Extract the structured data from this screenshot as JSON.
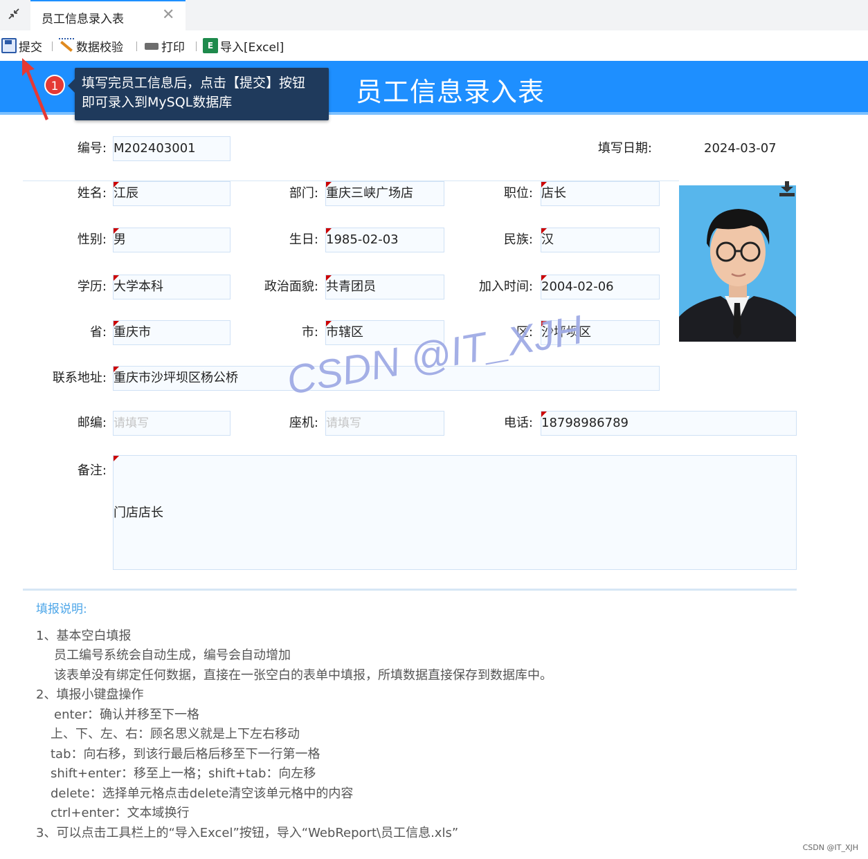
{
  "tab": {
    "title": "员工信息录入表",
    "close": "✕"
  },
  "toolbar": {
    "submit": "提交",
    "validate": "数据校验",
    "print": "打印",
    "import": "导入[Excel]",
    "excel_glyph": "E"
  },
  "banner": {
    "title": "员工信息录入表"
  },
  "annotation": {
    "badge": "1",
    "line1": "填写完员工信息后，点击【提交】按钮",
    "line2": "即可录入到MySQL数据库"
  },
  "form": {
    "id_label": "编号:",
    "id_value": "M202403001",
    "date_label": "填写日期:",
    "date_value": "2024-03-07",
    "name_label": "姓名:",
    "name_value": "江辰",
    "dept_label": "部门:",
    "dept_value": "重庆三峡广场店",
    "position_label": "职位:",
    "position_value": "店长",
    "gender_label": "性别:",
    "gender_value": "男",
    "birth_label": "生日:",
    "birth_value": "1985-02-03",
    "ethnic_label": "民族:",
    "ethnic_value": "汉",
    "edu_label": "学历:",
    "edu_value": "大学本科",
    "politics_label": "政治面貌:",
    "politics_value": "共青团员",
    "join_label": "加入时间:",
    "join_value": "2004-02-06",
    "province_label": "省:",
    "province_value": "重庆市",
    "city_label": "市:",
    "city_value": "市辖区",
    "district_label": "区:",
    "district_value": "沙坪坝区",
    "address_label": "联系地址:",
    "address_value": "重庆市沙坪坝区杨公桥",
    "zip_label": "邮编:",
    "zip_placeholder": "请填写",
    "landline_label": "座机:",
    "landline_placeholder": "请填写",
    "phone_label": "电话:",
    "phone_value": "18798986789",
    "remark_label": "备注:",
    "remark_value": "门店店长"
  },
  "watermark": "CSDN @IT_XJH",
  "notes": {
    "title": "填报说明:",
    "lines": [
      "1、基本空白填报",
      "员工编号系统会自动生成，编号会自动增加",
      "该表单没有绑定任何数据，直接在一张空白的表单中填报，所填数据直接保存到数据库中。",
      "2、填报小键盘操作",
      "enter：确认并移至下一格",
      "上、下、左、右：顾名思义就是上下左右移动",
      "tab：向右移，到该行最后格后移至下一行第一格",
      "shift+enter：移至上一格；shift+tab：向左移",
      "delete：选择单元格点击delete清空该单元格中的内容",
      "ctrl+enter：文本域换行",
      "3、可以点击工具栏上的“导入Excel”按钮，导入“WebReport\\员工信息.xls”"
    ]
  },
  "credit": "CSDN @IT_XJH",
  "colors": {
    "banner": "#1e8fff",
    "tooltip": "#1f3a5c",
    "badge": "#e53935",
    "required_mark": "#cc0000"
  }
}
